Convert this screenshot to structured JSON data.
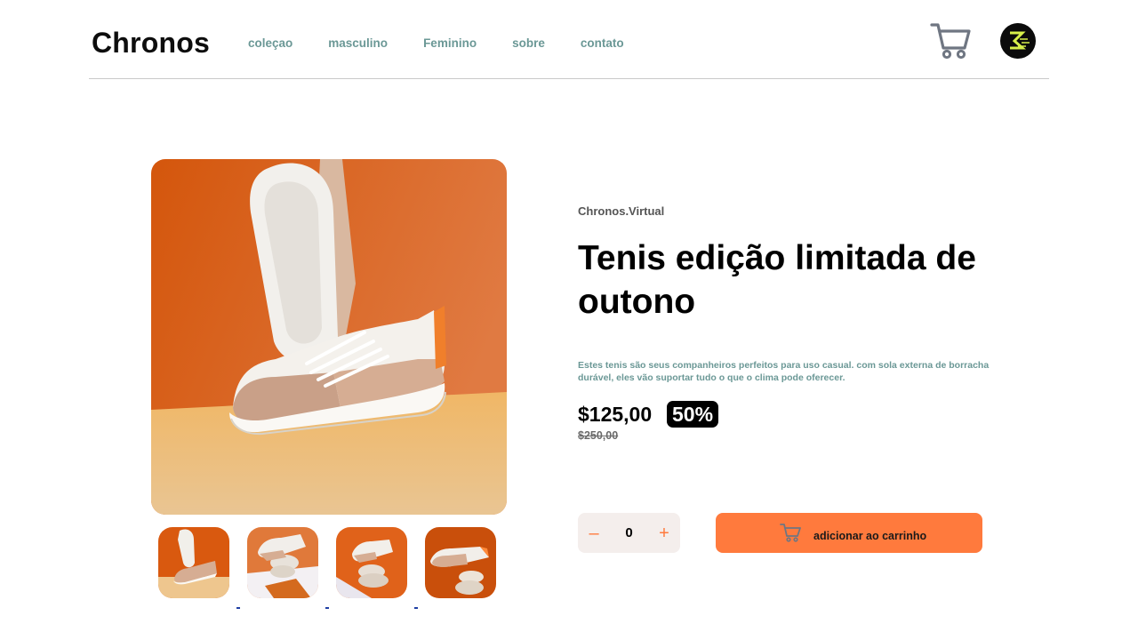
{
  "header": {
    "logo": "Chronos",
    "nav": [
      "coleçao",
      "masculino",
      "Feminino",
      "sobre",
      "contato"
    ],
    "cart_icon": "cart-icon",
    "avatar_icon": "avatar-logo"
  },
  "gallery": {
    "main_image": "sneaker-on-orange-background",
    "thumbnails": [
      "sneaker-thumbnail-1",
      "sneaker-thumbnail-2",
      "sneaker-thumbnail-3",
      "sneaker-thumbnail-4"
    ]
  },
  "product": {
    "brand": "Chronos.Virtual",
    "title": "Tenis edição limitada de outono",
    "description": "Estes tenis são seus companheiros perfeitos para uso casual. com sola externa de borracha durável, eles vão suportar tudo o que o clima pode oferecer.",
    "price": "$125,00",
    "discount": "50%",
    "old_price": "$250,00"
  },
  "quantity": {
    "minus": "–",
    "value": "0",
    "plus": "+"
  },
  "add_to_cart": {
    "label": "adicionar ao carrinho",
    "icon": "cart-icon"
  },
  "colors": {
    "accent": "#ff7a3d",
    "nav_text": "#6b9896",
    "qty_bg": "#f4eeec"
  }
}
